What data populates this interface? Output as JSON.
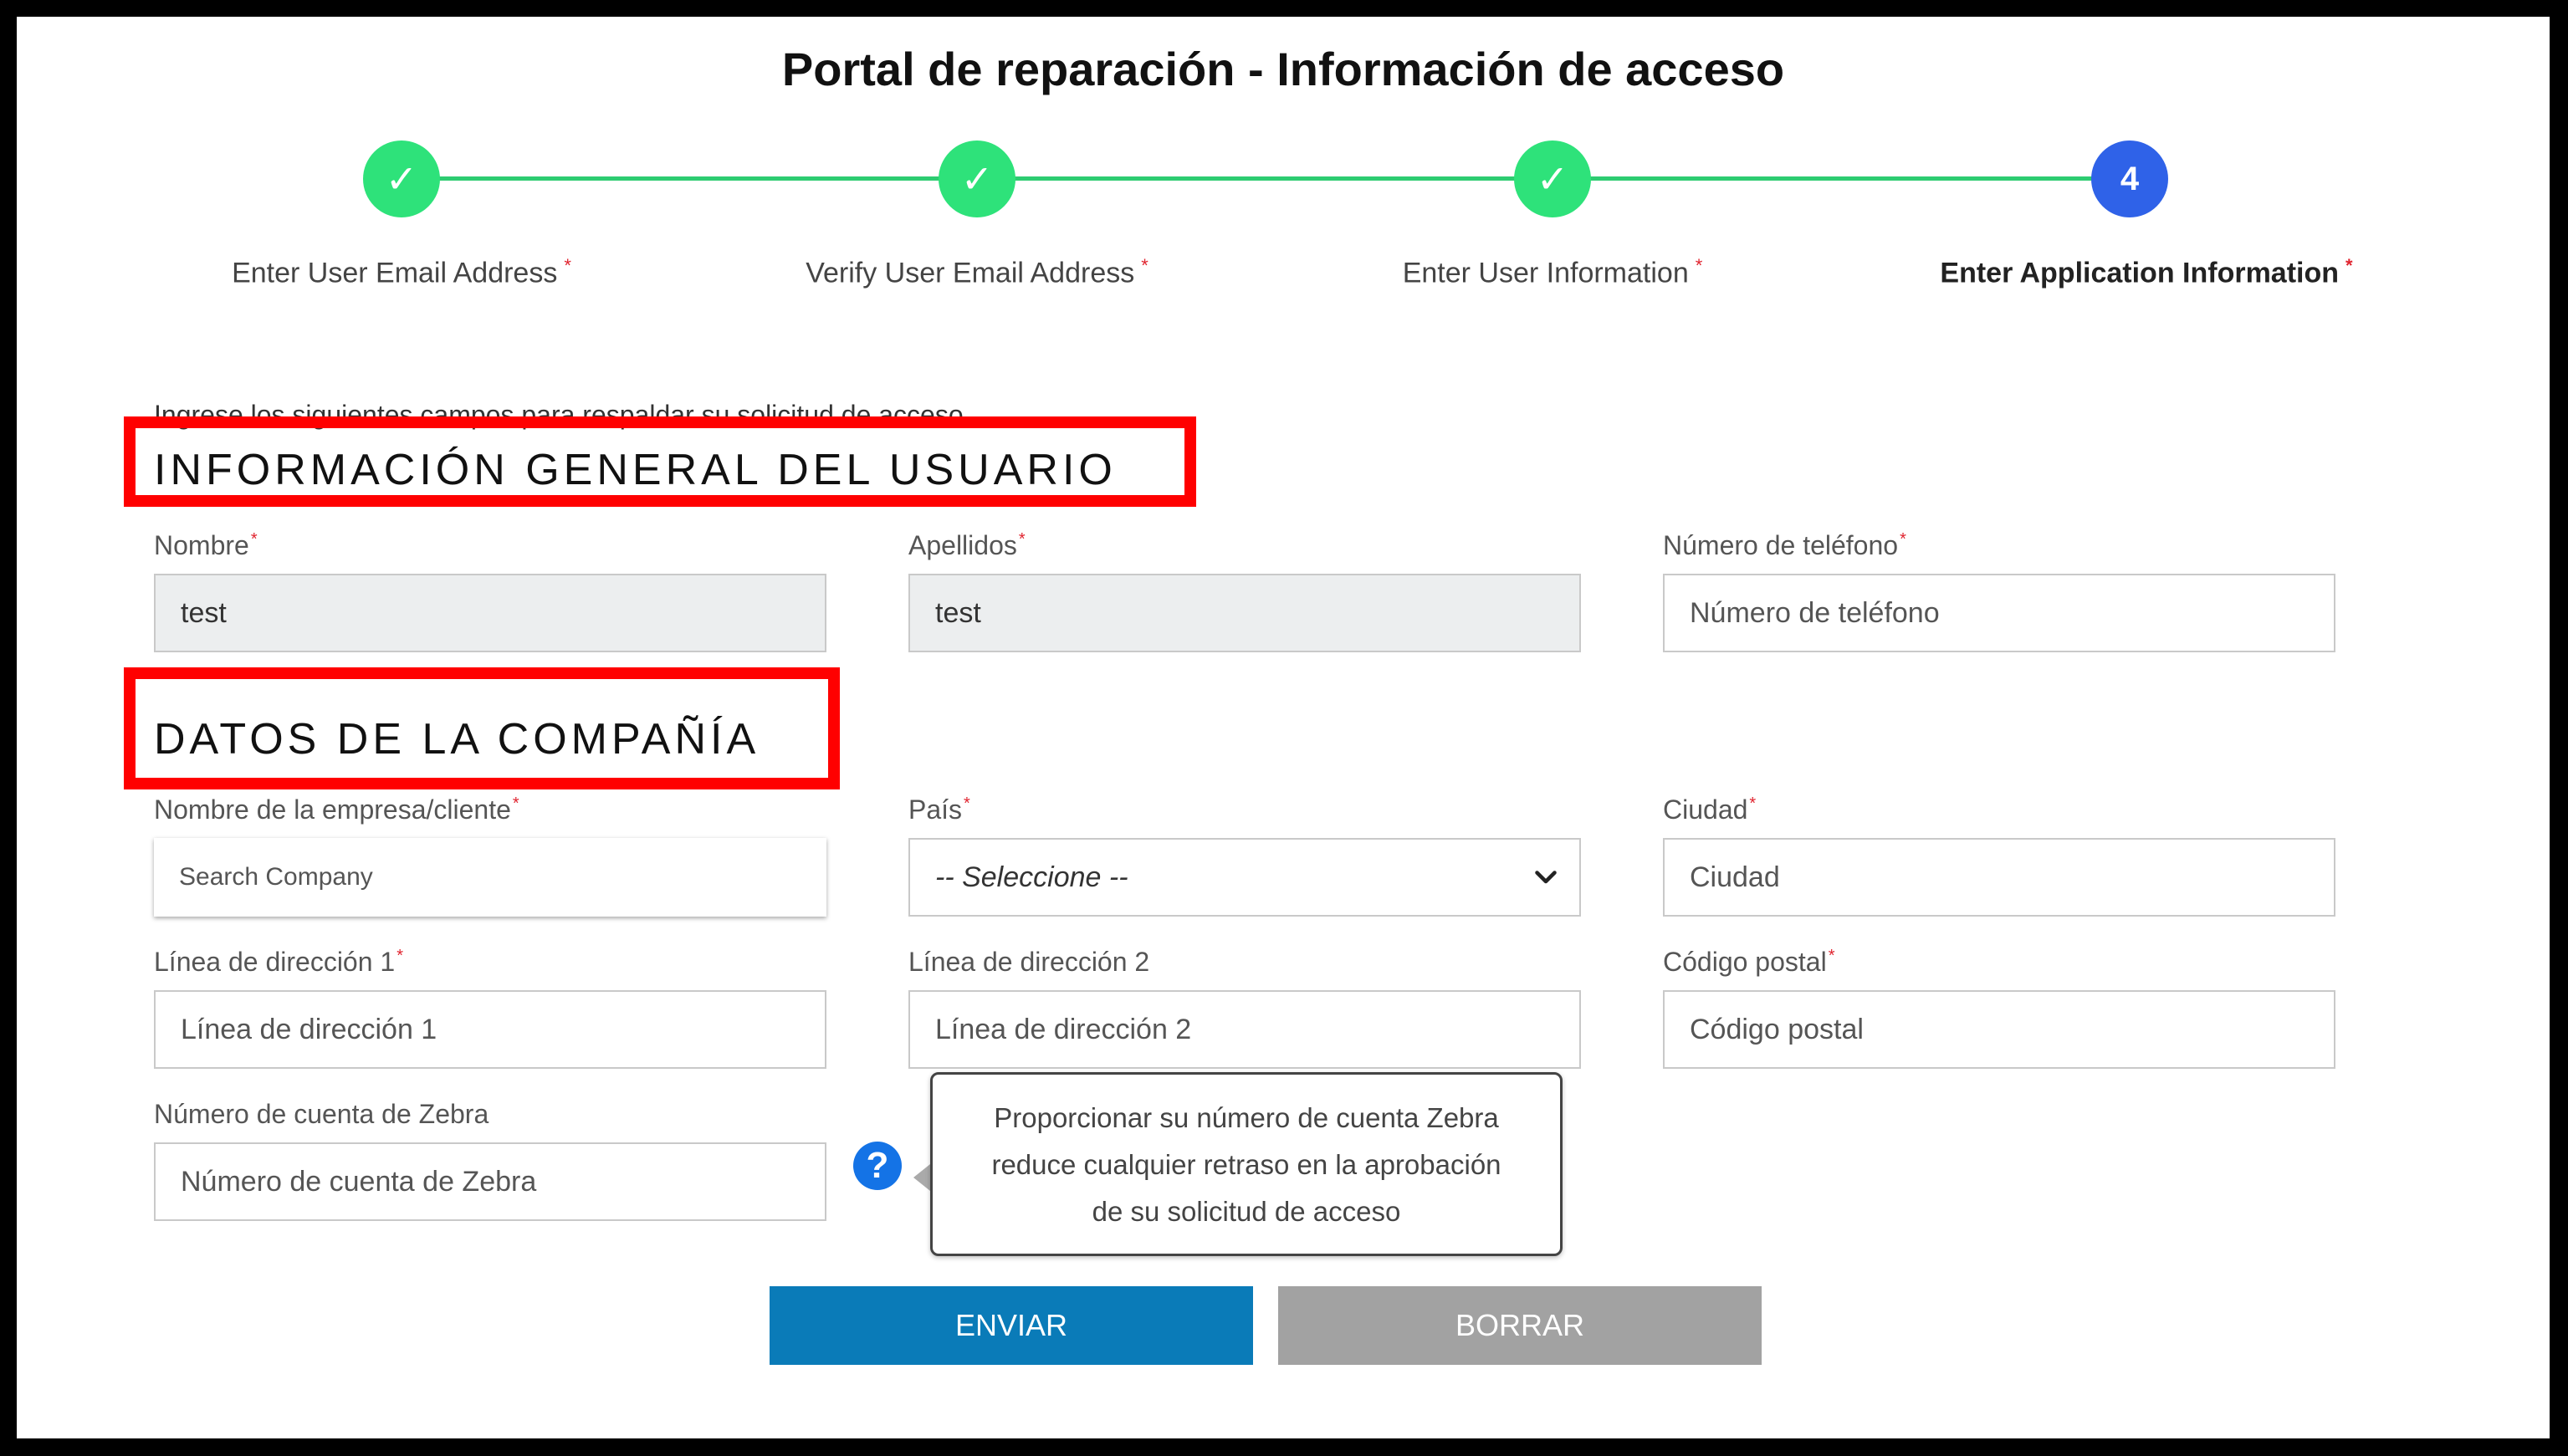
{
  "page": {
    "title": "Portal de reparación - Información de acceso"
  },
  "stepper": {
    "steps": [
      {
        "label": "Enter User Email Address",
        "marker": "✓",
        "state": "done"
      },
      {
        "label": "Verify User Email Address",
        "marker": "✓",
        "state": "done"
      },
      {
        "label": "Enter User Information",
        "marker": "✓",
        "state": "done"
      },
      {
        "label": "Enter Application Information",
        "marker": "4",
        "state": "current"
      }
    ],
    "required_mark": "*",
    "colors": {
      "done": "#2ee27a",
      "current": "#2f62e8",
      "line": "#2ecc71"
    }
  },
  "intro": "Ingrese los siguientes campos para respaldar su solicitud de acceso",
  "sections": {
    "user": {
      "title": "INFORMACIÓN GENERAL DEL USUARIO"
    },
    "company": {
      "title": "DATOS DE LA COMPAÑÍA"
    }
  },
  "fields": {
    "first_name": {
      "label": "Nombre",
      "value": "test"
    },
    "last_name": {
      "label": "Apellidos",
      "value": "test"
    },
    "phone": {
      "label": "Número de teléfono",
      "placeholder": "Número de teléfono"
    },
    "company": {
      "label": "Nombre de la empresa/cliente",
      "placeholder": "Search Company"
    },
    "country": {
      "label": "País",
      "selected": "-- Seleccione --"
    },
    "city": {
      "label": "Ciudad",
      "placeholder": "Ciudad"
    },
    "address1": {
      "label": "Línea de dirección 1",
      "placeholder": "Línea de dirección 1"
    },
    "address2": {
      "label": "Línea de dirección 2",
      "placeholder": "Línea de dirección 2"
    },
    "postal": {
      "label": "Código postal",
      "placeholder": "Código postal"
    },
    "zebra_account": {
      "label": "Número de cuenta de Zebra",
      "placeholder": "Número de cuenta de Zebra"
    }
  },
  "tooltip": {
    "icon": "question-icon",
    "lines": [
      "Proporcionar su número de cuenta Zebra",
      "reduce cualquier retraso en la aprobación",
      "de su solicitud de acceso"
    ]
  },
  "buttons": {
    "submit": "ENVIAR",
    "clear": "BORRAR"
  },
  "colors": {
    "highlight": "#ff0000",
    "submit": "#0a7bb8",
    "clear": "#a2a2a2"
  }
}
